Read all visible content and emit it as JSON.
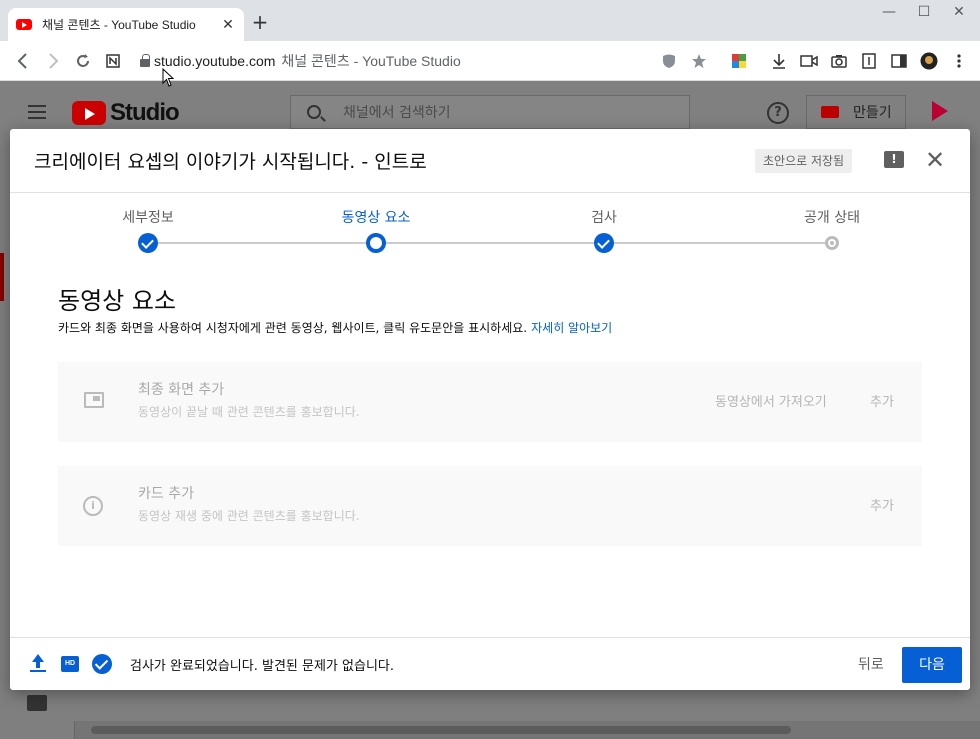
{
  "browser": {
    "tab_title": "채널 콘텐츠 - YouTube Studio",
    "tab_close": "✕",
    "new_tab": "+",
    "url": "studio.youtube.com",
    "page_title": "채널 콘텐츠 - YouTube Studio",
    "window_controls": [
      "—",
      "☐",
      "✕"
    ]
  },
  "studio": {
    "logo_text": "Studio",
    "search_placeholder": "채널에서 검색하기",
    "help_label": "?",
    "create_label": "만들기"
  },
  "dialog": {
    "title": "크리에이터 요셉의 이야기가 시작됩니다. - 인트로",
    "draft_badge": "초안으로 저장됨",
    "feedback_icon_label": "!",
    "close_label": "✕",
    "steps": [
      {
        "label": "세부정보",
        "state": "done"
      },
      {
        "label": "동영상 요소",
        "state": "current"
      },
      {
        "label": "검사",
        "state": "done"
      },
      {
        "label": "공개 상태",
        "state": "todo"
      }
    ],
    "section": {
      "heading": "동영상 요소",
      "description": "카드와 최종 화면을 사용하여 시청자에게 관련 동영상, 웹사이트, 클릭 유도문안을 표시하세요.",
      "learn_more": "자세히 알아보기"
    },
    "cards": [
      {
        "icon": "end-screen-icon",
        "title": "최종 화면 추가",
        "subtitle": "동영상이 끝날 때 관련 콘텐츠를 홍보합니다.",
        "import_label": "동영상에서 가져오기",
        "add_label": "추가"
      },
      {
        "icon": "info-icon",
        "title": "카드 추가",
        "subtitle": "동영상 재생 중에 관련 콘텐츠를 홍보합니다.",
        "add_label": "추가"
      }
    ],
    "footer": {
      "status": "검사가 완료되었습니다. 발견된 문제가 없습니다.",
      "hd_label": "HD",
      "back_label": "뒤로",
      "next_label": "다음"
    }
  },
  "colors": {
    "accent": "#065fd4",
    "brand_red": "#ff0000"
  }
}
